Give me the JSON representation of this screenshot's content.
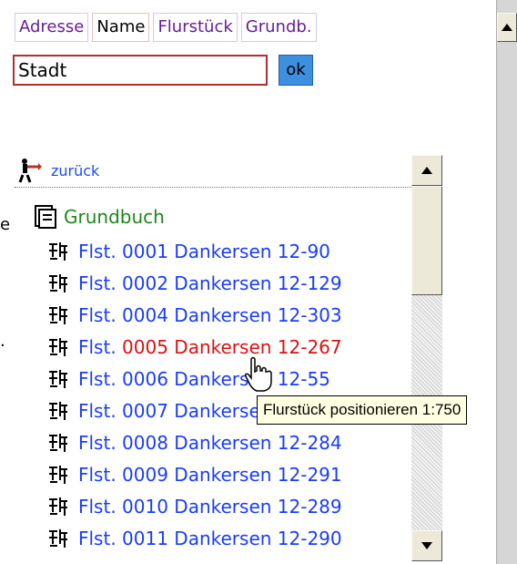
{
  "tabs": [
    {
      "label": "Adresse",
      "active": false
    },
    {
      "label": "Name",
      "active": true
    },
    {
      "label": "Flurstück",
      "active": false
    },
    {
      "label": "Grundb.",
      "active": false
    }
  ],
  "search": {
    "value": "Stadt",
    "ok_label": "ok"
  },
  "back": {
    "label": "zurück"
  },
  "tree": {
    "root_label": "Grundbuch",
    "items": [
      {
        "prefix": "Flst. ",
        "text": "0001 Dankersen 12-90"
      },
      {
        "prefix": "Flst. ",
        "text": "0002 Dankersen 12-129"
      },
      {
        "prefix": "Flst. ",
        "text": "0004 Dankersen 12-303"
      },
      {
        "prefix": "Flst. ",
        "text": "0005 Dankersen 12-267"
      },
      {
        "prefix": "Flst. ",
        "text": "0006 Dankersen 12-55"
      },
      {
        "prefix": "Flst. ",
        "text": "0007 Dankersen 12-"
      },
      {
        "prefix": "Flst. ",
        "text": "0008 Dankersen 12-284"
      },
      {
        "prefix": "Flst. ",
        "text": "0009 Dankersen 12-291"
      },
      {
        "prefix": "Flst. ",
        "text": "0010 Dankersen 12-289"
      },
      {
        "prefix": "Flst. ",
        "text": "0011 Dankersen 12-290"
      }
    ]
  },
  "tooltip": {
    "text": "Flurstück positionieren 1:750"
  },
  "edge": {
    "char_top": "e",
    "char_bottom": "."
  },
  "colors": {
    "link": "#1a3cff",
    "hover": "#e01010",
    "root": "#1a8a1a",
    "ok_bg": "#3d8fe0",
    "input_border": "#b03030"
  },
  "icons": [
    "back-person-icon",
    "book-icon",
    "parcel-icon",
    "hand-cursor-icon",
    "arrow-up-icon",
    "arrow-down-icon"
  ]
}
